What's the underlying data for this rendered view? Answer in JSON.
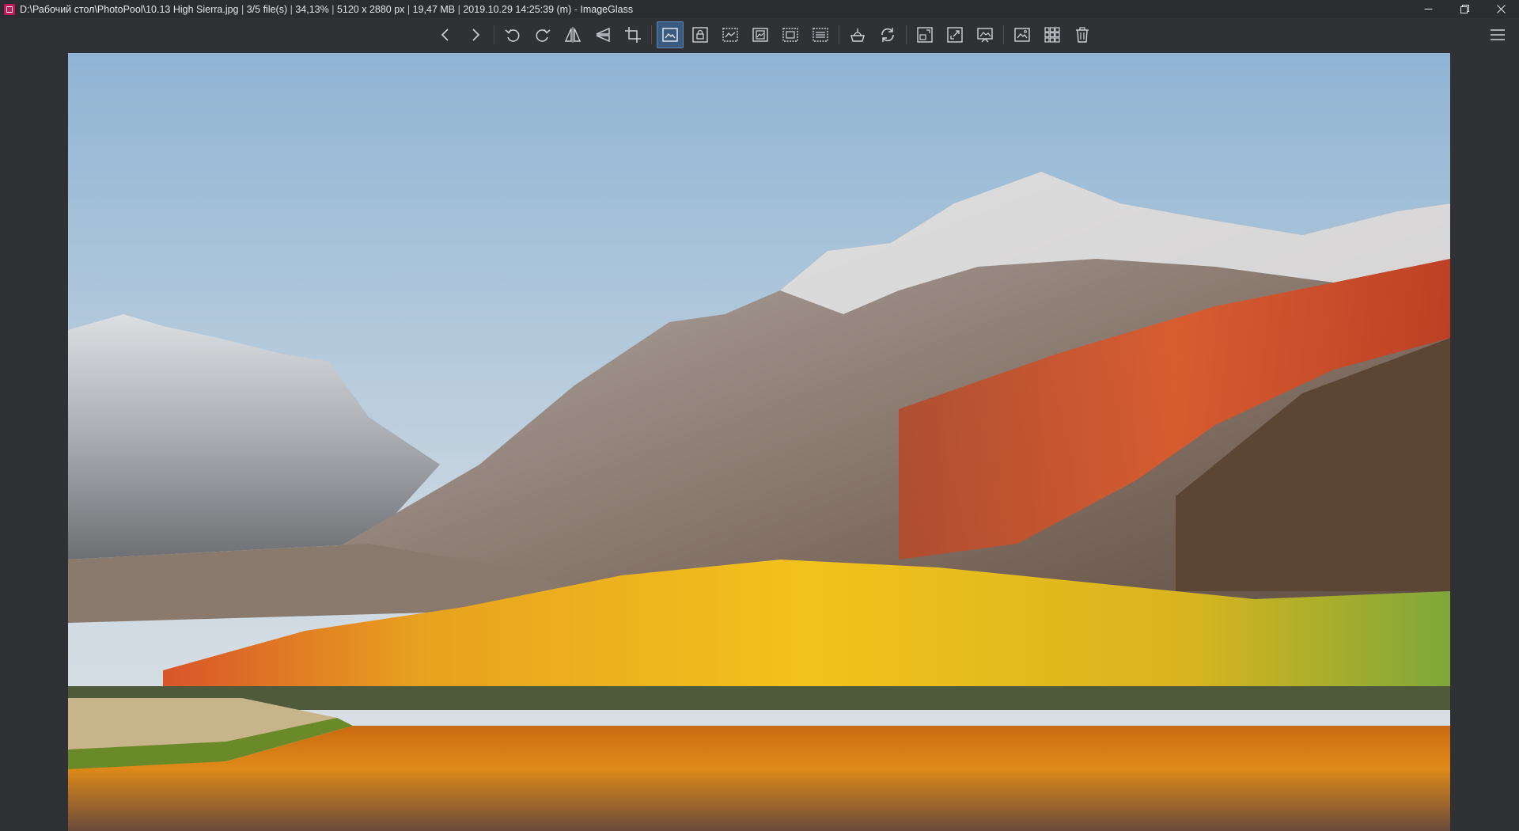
{
  "window": {
    "title_parts": [
      "D:\\Рабочий стол\\PhotoPool\\10.13 High Sierra.jpg",
      "3/5 file(s)",
      "34,13%",
      "5120 x 2880 px",
      "19,47 MB",
      "2019.10.29 14:25:39 (m)"
    ],
    "app_name": "ImageGlass",
    "separator": "  |  ",
    "app_separator": "  - ",
    "controls": {
      "minimize": "minimize-icon",
      "restore": "restore-icon",
      "close": "close-icon"
    }
  },
  "toolbar": {
    "groups": [
      [
        "previous-image",
        "next-image"
      ],
      [
        "rotate-left",
        "rotate-right",
        "flip-horizontal",
        "flip-vertical",
        "crop"
      ],
      [
        "auto-zoom",
        "lock-zoom-ratio",
        "scale-to-width",
        "scale-to-height",
        "scale-to-fit",
        "scale-to-fill"
      ],
      [
        "open-with",
        "refresh"
      ],
      [
        "go-to-image",
        "fullscreen",
        "slideshow"
      ],
      [
        "thumbnail-bar",
        "checkerboard",
        "delete"
      ]
    ],
    "active": "auto-zoom",
    "menu": "hamburger-menu-icon"
  },
  "colors": {
    "background": "#2f3134",
    "titlebar": "#2b2d30",
    "active_button": "#3a5a80",
    "icon": "#cfd3d8"
  },
  "image": {
    "subject": "macOS High Sierra wallpaper"
  }
}
